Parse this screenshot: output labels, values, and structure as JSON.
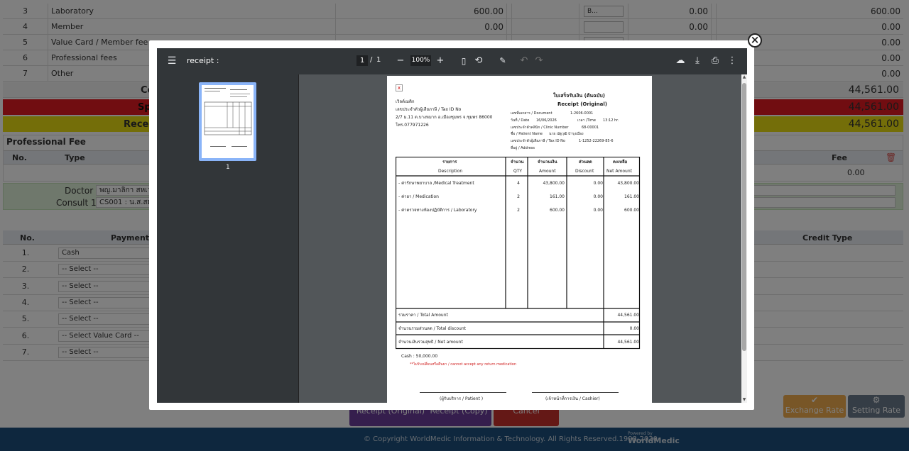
{
  "background": {
    "rows": [
      {
        "no": "3",
        "label": "Laboratory",
        "amount": "600.00",
        "select": "B...",
        "discount": "0.00",
        "net": "600.00"
      },
      {
        "no": "4",
        "label": "Member",
        "amount": "0.00",
        "select": "",
        "discount": "0.00",
        "net": "0.00"
      },
      {
        "no": "5",
        "label": "Value Card / Member fee",
        "amount": "",
        "select": "",
        "discount": "",
        "net": "0.00"
      },
      {
        "no": "6",
        "label": "Professional fees",
        "amount": "",
        "select": "",
        "discount": "",
        "net": "0.00"
      },
      {
        "no": "7",
        "label": "Other",
        "amount": "",
        "select": "",
        "discount": "",
        "net": "0.00"
      }
    ],
    "summary": [
      {
        "label": "Co",
        "value": "44,561.00",
        "color": "#f2f2f2"
      },
      {
        "label": "Spe",
        "value": "44,561.00",
        "color": "#e31b23"
      },
      {
        "label": "Receipt",
        "value": "44,561.00",
        "color": "#e9dc12"
      }
    ],
    "prof_fee_title": "Professional Fee",
    "prof_no": "No.",
    "prof_type": "Type",
    "prof_fee": "Fee",
    "prof_fee_val": "0.00",
    "doctor_label": "Doctor :",
    "doctor_value": "พญ.มาลิกา สหเวช",
    "consult_label": "Consult 1 :",
    "consult_value": "CS001 : น.ส.สมพ",
    "pay_no": "No.",
    "pay_type": "Payment Typ",
    "credit_type": "Credit Type",
    "payments": [
      {
        "no": "1.",
        "value": "Cash"
      },
      {
        "no": "2.",
        "value": "-- Select --"
      },
      {
        "no": "3.",
        "value": "-- Select --"
      },
      {
        "no": "4.",
        "value": "-- Select --"
      },
      {
        "no": "5.",
        "value": "-- Select --"
      },
      {
        "no": "6.",
        "value": "-- Select Value Card --"
      },
      {
        "no": "7.",
        "value": "-- Select --"
      }
    ],
    "btn_receipt_original": "Receipt (Original)",
    "btn_receipt_copy": "Receipt (Copy)",
    "btn_cancel": "Cancel",
    "btn_exchange": "Exchange Rate",
    "btn_setting": "Setting Rate",
    "copyright": "© Copyright WorldMedic Information & Technology. All Rights Reserved.1998-2030",
    "powered_by": "Powered by",
    "brand": "WorldMedic"
  },
  "viewer": {
    "title": "receipt :",
    "page_current": "1",
    "page_sep": "/",
    "page_total": "1",
    "zoom": "100%",
    "thumb_label": "1"
  },
  "receipt": {
    "logo_alt": "x",
    "clinic_line1": "เวิลด์เมดิก",
    "clinic_line2": "เลขประจำตัวผู้เสียภาษี / Tax ID No",
    "clinic_line3": "2/7 ม.11 ต.บางหมาก อ.เมืองชุมพร จ.ชุมพร 86000",
    "clinic_line4": "โทร.077971226",
    "title_th": "ใบเสร็จรับเงิน (ต้นฉบับ)",
    "title_en": "Receipt (Original)",
    "doc_label": "เลขที่เอกสาร / Document",
    "doc_value": "1-2606-0001",
    "date_label": "วันที่ / Date",
    "date_value": "16/06/2026",
    "time_label": "เวลา /Time",
    "time_value": "13:12 hr.",
    "clinic_no_label": "เลขประจำตัวคลินิก / Clinic Number",
    "clinic_no_value": "68-00001",
    "patient_label": "ชื่อ / Patient Name",
    "patient_value": "นาย ณัฐวุฒิ บำรุงเมือง",
    "tax_label": "เลขประจำตัวผู้เสียภาษี / Tax ID No",
    "tax_value": "1-1252-22269-85-6",
    "address_label": "ที่อยู่ / Address",
    "h_desc_th": "รายการ",
    "h_desc_en": "Description",
    "h_qty_th": "จำนวน",
    "h_qty_en": "QTY",
    "h_amt_th": "จำนวนเงิน",
    "h_amt_en": "Amount",
    "h_disc_th": "ส่วนลด",
    "h_disc_en": "Discount",
    "h_net_th": "คงเหลือ",
    "h_net_en": "Net Amount",
    "items": [
      {
        "desc": "- ค่ารักษาพยาบาล /Medical Treatment",
        "qty": "4",
        "amount": "43,800.00",
        "discount": "0.00",
        "net": "43,800.00"
      },
      {
        "desc": "- ค่ายา / Medication",
        "qty": "2",
        "amount": "161.00",
        "discount": "0.00",
        "net": "161.00"
      },
      {
        "desc": "- ค่าตรวจทางห้องปฏิบัติการ / Laboratory",
        "qty": "2",
        "amount": "600.00",
        "discount": "0.00",
        "net": "600.00"
      }
    ],
    "total_label": "รวมราคา / Total Amount",
    "total_value": "44,561.00",
    "disc_label": "จำนวนรวมส่วนลด / Total discount",
    "disc_value": "0.00",
    "net_label": "จำนวนเงินรวมสุทธิ / Net amount",
    "net_value": "44,561.00",
    "cash_line": "Cash : 50,000.00",
    "note": "**ไม่รับเปลี่ยนหรือคืนยา / cannot accept any return medication",
    "sign_patient": "(ผู้รับบริการ / Patient )",
    "sign_cashier": "(เจ้าหน้าที่การเงิน / Cashier)"
  }
}
